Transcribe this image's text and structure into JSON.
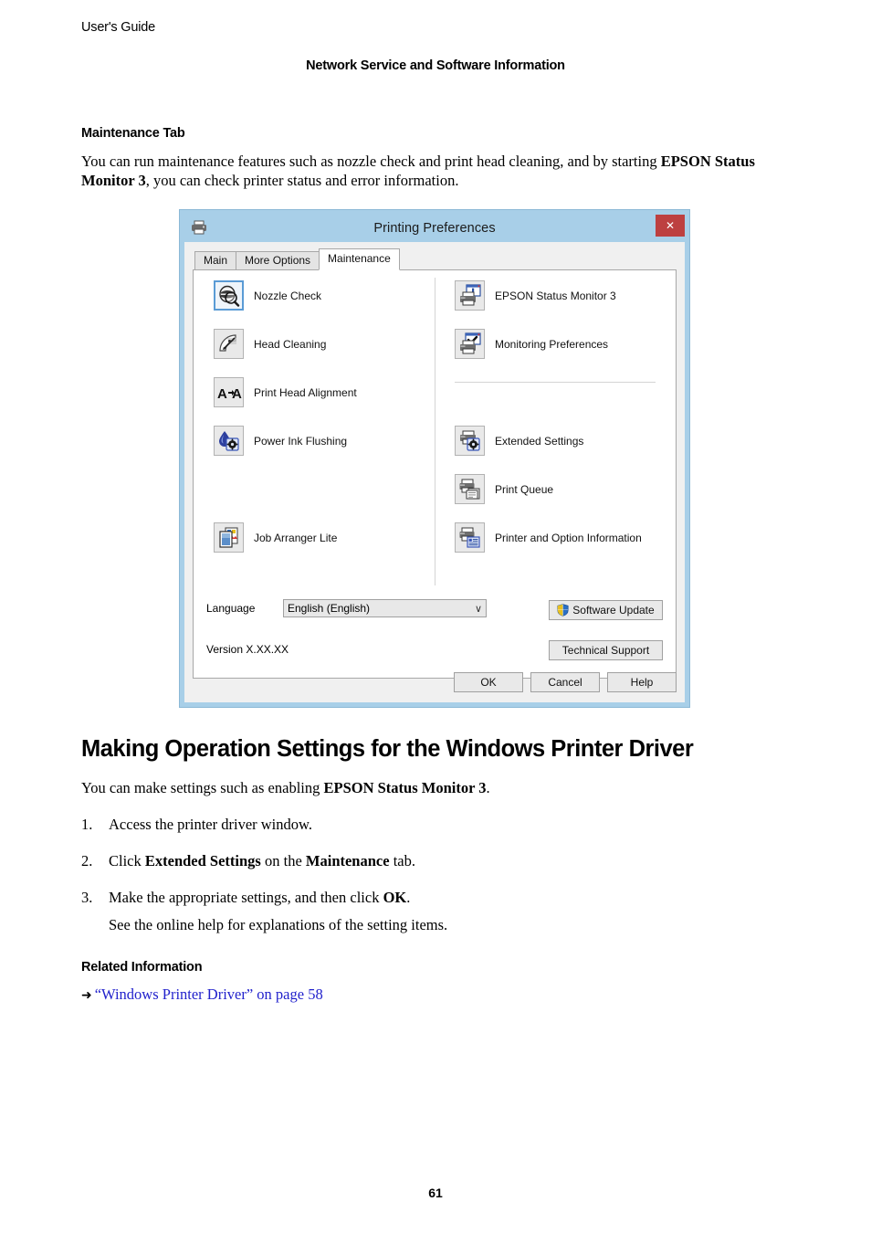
{
  "page": {
    "header_left": "User's Guide",
    "header_center": "Network Service and Software Information",
    "page_number": "61"
  },
  "sections": {
    "maintenance_tab_heading": "Maintenance Tab",
    "maintenance_tab_intro_1": "You can run maintenance features such as nozzle check and print head cleaning, and by starting ",
    "maintenance_tab_intro_bold": "EPSON Status Monitor 3",
    "maintenance_tab_intro_2": ", you can check printer status and error information.",
    "making_settings_heading": "Making Operation Settings for the Windows Printer Driver",
    "making_settings_intro_1": "You can make settings such as enabling ",
    "making_settings_intro_bold": "EPSON Status Monitor 3",
    "making_settings_intro_2": ".",
    "steps": [
      {
        "num": "1.",
        "text": "Access the printer driver window."
      },
      {
        "num": "2.",
        "pre": "Click ",
        "bold1": "Extended Settings",
        "mid": " on the ",
        "bold2": "Maintenance",
        "post": " tab."
      },
      {
        "num": "3.",
        "pre": "Make the appropriate settings, and then click ",
        "bold1": "OK",
        "post": ".",
        "sub": "See the online help for explanations of the setting items."
      }
    ],
    "related_information_heading": "Related Information",
    "related_link": "“Windows Printer Driver” on page 58",
    "related_link_arrow": "➜"
  },
  "dialog": {
    "title": "Printing Preferences",
    "titlebar_icon": "printer-icon",
    "close_label": "✕",
    "tabs": [
      {
        "label": "Main",
        "active": false
      },
      {
        "label": "More Options",
        "active": false
      },
      {
        "label": "Maintenance",
        "active": true
      }
    ],
    "left_items": [
      {
        "label": "Nozzle Check",
        "icon": "nozzle-check-icon",
        "selected": true
      },
      {
        "label": "Head Cleaning",
        "icon": "head-cleaning-icon",
        "selected": false
      },
      {
        "label": "Print Head Alignment",
        "icon": "print-head-alignment-icon",
        "selected": false
      },
      {
        "label": "Power Ink Flushing",
        "icon": "power-ink-flushing-icon",
        "selected": false
      },
      {
        "label": "Job Arranger Lite",
        "icon": "job-arranger-lite-icon",
        "selected": false
      }
    ],
    "right_items": [
      {
        "label": "EPSON Status Monitor 3",
        "icon": "status-monitor-icon",
        "selected": false
      },
      {
        "label": "Monitoring Preferences",
        "icon": "monitoring-preferences-icon",
        "selected": false
      },
      {
        "label": "Extended Settings",
        "icon": "extended-settings-icon",
        "selected": false
      },
      {
        "label": "Print Queue",
        "icon": "print-queue-icon",
        "selected": false
      },
      {
        "label": "Printer and Option Information",
        "icon": "printer-option-info-icon",
        "selected": false
      }
    ],
    "language_label": "Language",
    "language_value": "English (English)",
    "language_arrow": "∨",
    "version_label": "Version  X.XX.XX",
    "software_update_label": "Software Update",
    "software_update_icon": "shield-icon",
    "technical_support_label": "Technical Support",
    "buttons": [
      {
        "label": "OK"
      },
      {
        "label": "Cancel"
      },
      {
        "label": "Help"
      }
    ]
  },
  "colors": {
    "titlebar": "#a8cfe8",
    "close_button": "#bd4040",
    "link": "#2222cc",
    "panel_bg": "#ffffff",
    "dialog_bg": "#f0f0f0",
    "selected_outline": "#5a9bd5"
  }
}
